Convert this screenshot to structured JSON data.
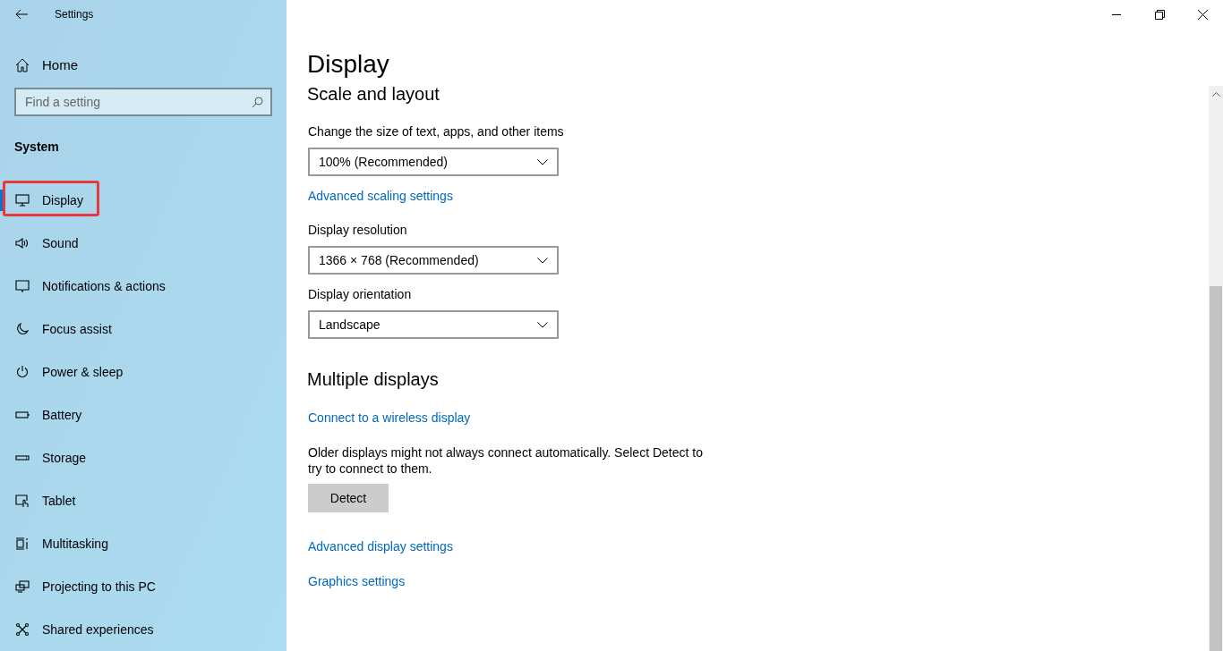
{
  "window": {
    "title": "Settings"
  },
  "sidebar": {
    "home": "Home",
    "search": {
      "placeholder": "Find a setting"
    },
    "section": "System",
    "items": [
      {
        "label": "Display",
        "selected": true,
        "highlighted": true
      },
      {
        "label": "Sound",
        "selected": false,
        "highlighted": false
      },
      {
        "label": "Notifications & actions",
        "selected": false,
        "highlighted": false
      },
      {
        "label": "Focus assist",
        "selected": false,
        "highlighted": false
      },
      {
        "label": "Power & sleep",
        "selected": false,
        "highlighted": false
      },
      {
        "label": "Battery",
        "selected": false,
        "highlighted": false
      },
      {
        "label": "Storage",
        "selected": false,
        "highlighted": false
      },
      {
        "label": "Tablet",
        "selected": false,
        "highlighted": false
      },
      {
        "label": "Multitasking",
        "selected": false,
        "highlighted": false
      },
      {
        "label": "Projecting to this PC",
        "selected": false,
        "highlighted": false
      },
      {
        "label": "Shared experiences",
        "selected": false,
        "highlighted": false
      }
    ]
  },
  "page": {
    "title": "Display",
    "sections": [
      {
        "heading": "Scale and layout",
        "blocks": [
          {
            "kind": "label",
            "text": "Change the size of text, apps, and other items"
          },
          {
            "kind": "dropdown",
            "value": "100% (Recommended)"
          },
          {
            "kind": "link",
            "text": "Advanced scaling settings"
          },
          {
            "kind": "label",
            "text": "Display resolution"
          },
          {
            "kind": "dropdown",
            "value": "1366 × 768 (Recommended)"
          },
          {
            "kind": "label",
            "text": "Display orientation"
          },
          {
            "kind": "dropdown",
            "value": "Landscape"
          }
        ]
      },
      {
        "heading": "Multiple displays",
        "blocks": [
          {
            "kind": "link",
            "text": "Connect to a wireless display"
          },
          {
            "kind": "paragraph",
            "text": "Older displays might not always connect automatically. Select Detect to try to connect to them."
          },
          {
            "kind": "button",
            "text": "Detect"
          },
          {
            "kind": "link",
            "text": "Advanced display settings"
          },
          {
            "kind": "link",
            "text": "Graphics settings"
          }
        ]
      }
    ]
  }
}
